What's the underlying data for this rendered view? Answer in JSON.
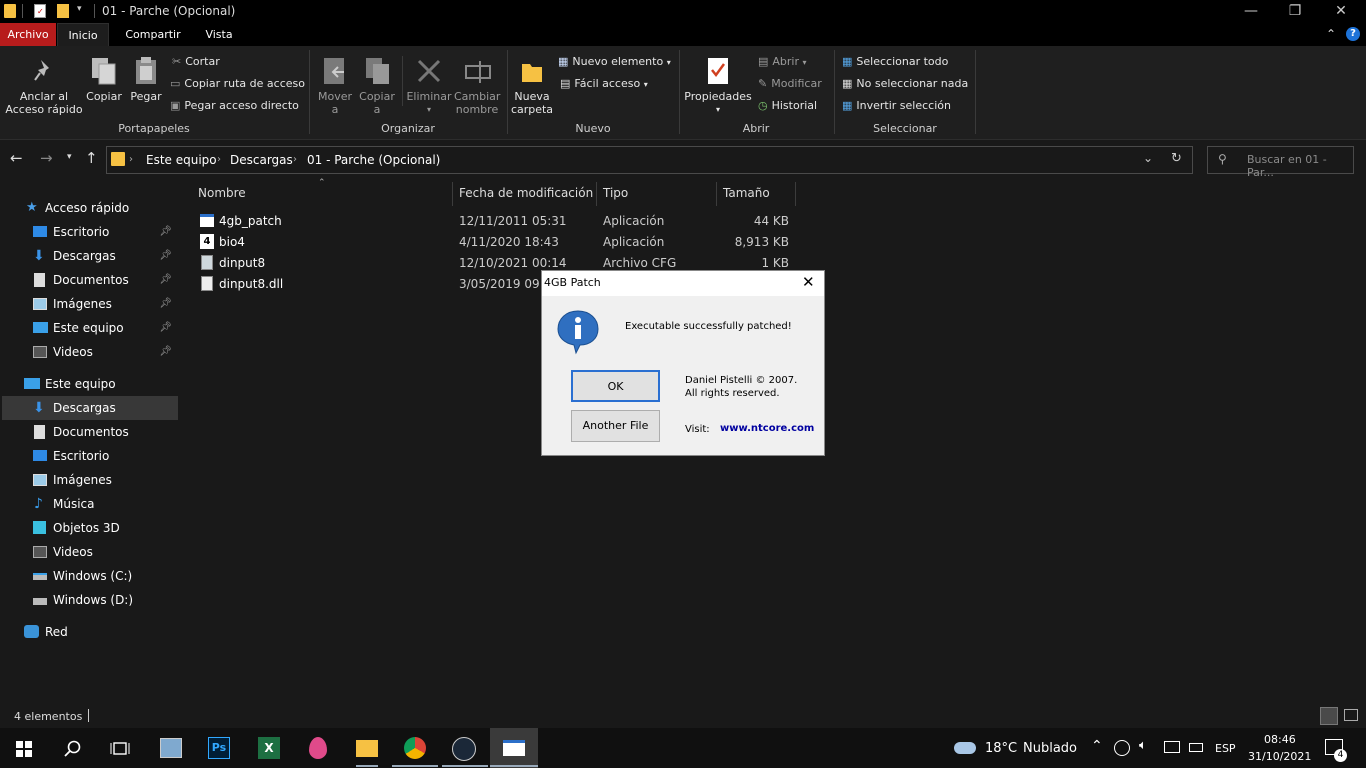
{
  "window": {
    "title": "01 - Parche (Opcional)",
    "minimize": "—",
    "maximize": "❐",
    "close": "✕"
  },
  "tabs": [
    {
      "label": "Archivo"
    },
    {
      "label": "Inicio"
    },
    {
      "label": "Compartir"
    },
    {
      "label": "Vista"
    }
  ],
  "ribbon": {
    "pin_label_1": "Anclar al",
    "pin_label_2": "Acceso rápido",
    "copy": "Copiar",
    "paste": "Pegar",
    "cut": "Cortar",
    "copy_path": "Copiar ruta de acceso",
    "paste_shortcut": "Pegar acceso directo",
    "group_clipboard": "Portapapeles",
    "move_1": "Mover",
    "move_2": "a",
    "copyto_1": "Copiar",
    "copyto_2": "a",
    "delete": "Eliminar",
    "rename_1": "Cambiar",
    "rename_2": "nombre",
    "group_organize": "Organizar",
    "newfolder_1": "Nueva",
    "newfolder_2": "carpeta",
    "new_item": "Nuevo elemento",
    "easy_access": "Fácil acceso",
    "group_new": "Nuevo",
    "properties": "Propiedades",
    "open": "Abrir",
    "edit": "Modificar",
    "history": "Historial",
    "group_open": "Abrir",
    "select_all": "Seleccionar todo",
    "select_none": "No seleccionar nada",
    "invert_selection": "Invertir selección",
    "group_select": "Seleccionar"
  },
  "address": {
    "crumbs": [
      {
        "label": "Este equipo"
      },
      {
        "label": "Descargas"
      },
      {
        "label": "01 - Parche (Opcional)"
      }
    ],
    "search_placeholder": "Buscar en 01 - Par..."
  },
  "nav": {
    "quick_access": "Acceso rápido",
    "quick_items": [
      {
        "label": "Escritorio"
      },
      {
        "label": "Descargas"
      },
      {
        "label": "Documentos"
      },
      {
        "label": "Imágenes"
      },
      {
        "label": "Este equipo"
      },
      {
        "label": "Videos"
      }
    ],
    "this_pc": "Este equipo",
    "pc_items": [
      {
        "label": "Descargas"
      },
      {
        "label": "Documentos"
      },
      {
        "label": "Escritorio"
      },
      {
        "label": "Imágenes"
      },
      {
        "label": "Música"
      },
      {
        "label": "Objetos 3D"
      },
      {
        "label": "Videos"
      },
      {
        "label": "Windows (C:)"
      },
      {
        "label": "Windows (D:)"
      }
    ],
    "network": "Red"
  },
  "columns": {
    "name": "Nombre",
    "date": "Fecha de modificación",
    "type": "Tipo",
    "size": "Tamaño"
  },
  "files": [
    {
      "name": "4gb_patch",
      "date": "12/11/2011 05:31",
      "type": "Aplicación",
      "size": "44 KB"
    },
    {
      "name": "bio4",
      "date": "4/11/2020 18:43",
      "type": "Aplicación",
      "size": "8,913 KB"
    },
    {
      "name": "dinput8",
      "date": "12/10/2021 00:14",
      "type": "Archivo CFG",
      "size": "1 KB"
    },
    {
      "name": "dinput8.dll",
      "date": "3/05/2019 09:47",
      "type": "",
      "size": ""
    }
  ],
  "status": {
    "count": "4 elementos"
  },
  "dialog": {
    "title": "4GB Patch",
    "message": "Executable successfully patched!",
    "ok": "OK",
    "another": "Another File",
    "credit_1": "Daniel Pistelli © 2007.",
    "credit_2": "All rights reserved.",
    "visit": "Visit:",
    "url": "www.ntcore.com"
  },
  "taskbar": {
    "weather_temp": "18°C",
    "weather_desc": "Nublado",
    "lang": "ESP",
    "time": "08:46",
    "date": "31/10/2021",
    "notif_count": "4"
  },
  "colors": {
    "accent": "#b71c1c",
    "folder": "#f6c143",
    "link": "#0000a0"
  }
}
